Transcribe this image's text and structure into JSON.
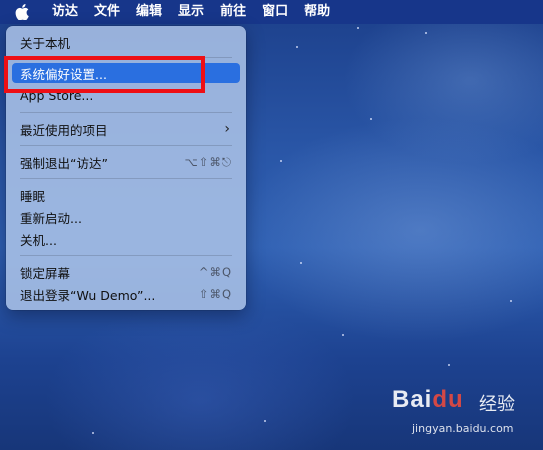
{
  "menubar": {
    "items": [
      {
        "label": "访达"
      },
      {
        "label": "文件"
      },
      {
        "label": "编辑"
      },
      {
        "label": "显示"
      },
      {
        "label": "前往"
      },
      {
        "label": "窗口"
      },
      {
        "label": "帮助"
      }
    ]
  },
  "apple_menu": {
    "about": "关于本机",
    "system_prefs": "系统偏好设置...",
    "app_store": "App Store...",
    "recent_items": "最近使用的项目",
    "force_quit": "强制退出“访达”",
    "force_quit_shortcut": "⌥⇧⌘⎋",
    "sleep": "睡眠",
    "restart": "重新启动...",
    "shutdown": "关机...",
    "lock_screen": "锁定屏幕",
    "lock_screen_shortcut": "^⌘Q",
    "logout": "退出登录“Wu Demo”...",
    "logout_shortcut": "⇧⌘Q"
  },
  "watermark": {
    "logo": "Bai",
    "logo_red": "du",
    "text": "经验",
    "url": "jingyan.baidu.com"
  },
  "colors": {
    "highlight_box": "#ee0f15",
    "selection": "#2a6fe0"
  }
}
